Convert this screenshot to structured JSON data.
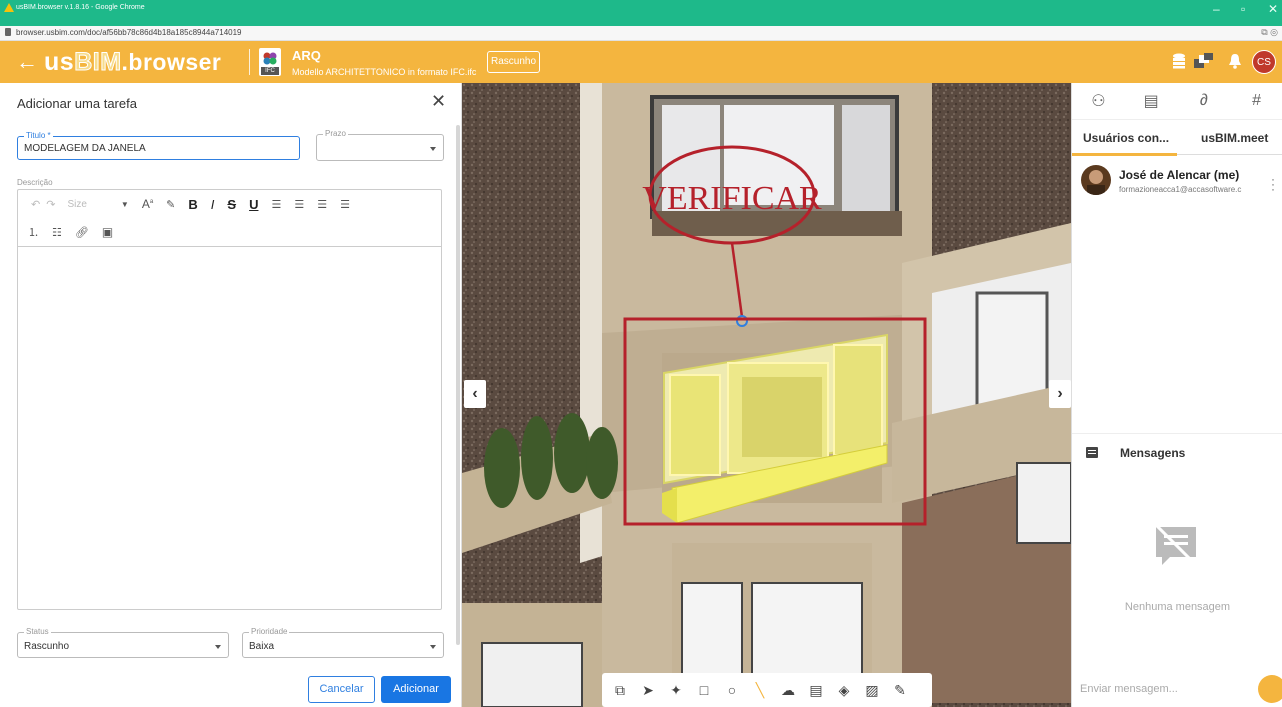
{
  "browser": {
    "window_title": "usBIM.browser v.1.8.16 - Google Chrome",
    "url": "browser.usbim.com/doc/af56bb78c86d4b18a185c8944a714019"
  },
  "header": {
    "logo_us": "us",
    "logo_bim": "BIM",
    "logo_browser": ".browser",
    "ifc_badge": "IFC",
    "project_code": "ARQ",
    "project_desc": "Modello ARCHITETTONICO in formato IFC.ifc",
    "status_chip": "Rascunho",
    "user_initials": "CS",
    "accent_color": "#f4b53f"
  },
  "task_form": {
    "title": "Adicionar uma tarefa",
    "title_field": {
      "label": "Titulo *",
      "value": "MODELAGEM DA JANELA"
    },
    "deadline_field": {
      "label": "Prazo",
      "value": ""
    },
    "description_label": "Descrição",
    "toolbar": {
      "size": "Size",
      "font_size": "A",
      "bold": "B",
      "italic": "I",
      "strike": "S",
      "underline": "U"
    },
    "status_field": {
      "label": "Status",
      "value": "Rascunho"
    },
    "priority_field": {
      "label": "Prioridade",
      "value": "Baixa"
    },
    "cancel_label": "Cancelar",
    "add_label": "Adicionar"
  },
  "viewport": {
    "annotation_text": "VERIFICAR",
    "annotation_color": "#b5212b",
    "highlight_color": "#f3ef6a"
  },
  "right_panel": {
    "tabs": [
      "Usuários con...",
      "usBIM.meet"
    ],
    "user": {
      "name": "José de Alencar (me)",
      "email": "formazioneacca1@accasoftware.c"
    },
    "messages_title": "Mensagens",
    "empty_text": "Nenhuma mensagem",
    "input_placeholder": "Enviar mensagem..."
  }
}
